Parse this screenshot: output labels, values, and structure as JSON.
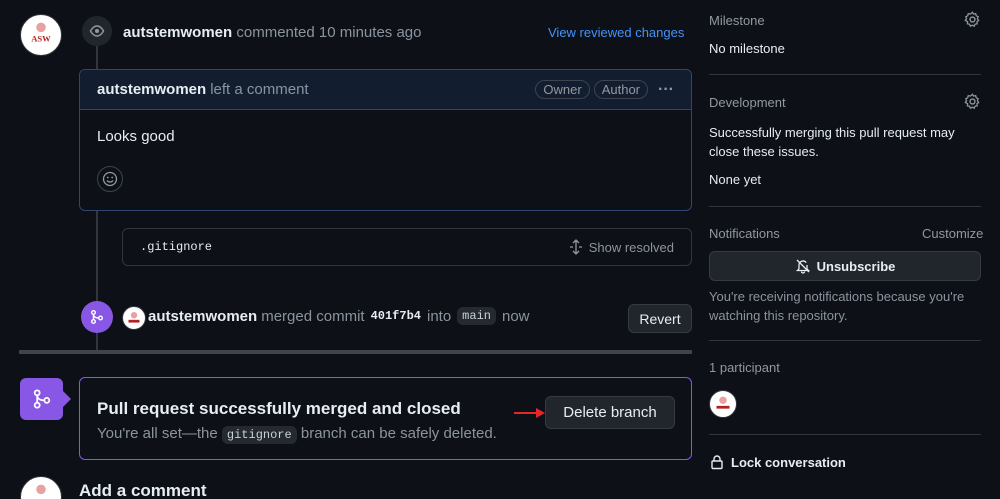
{
  "comment_header": {
    "author": "autstemwomen",
    "action": "commented 10 minutes ago",
    "view_changes": "View reviewed changes"
  },
  "comment": {
    "author": "autstemwomen",
    "action": "left a comment",
    "badge_owner": "Owner",
    "badge_author": "Author",
    "more": "···",
    "body": "Looks good"
  },
  "file_row": {
    "filename": ".gitignore",
    "show_resolved": "Show resolved"
  },
  "merge_event": {
    "author": "autstemwomen",
    "text_merged": "merged commit",
    "commit": "401f7b4",
    "text_into": "into",
    "branch": "main",
    "time": "now",
    "revert": "Revert"
  },
  "merged_box": {
    "title": "Pull request successfully merged and closed",
    "desc_before": "You're all set—the",
    "branch": "gitignore",
    "desc_after": "branch can be safely deleted.",
    "delete_branch": "Delete branch"
  },
  "add_comment": "Add a comment",
  "avatar_text": "ASW",
  "sidebar": {
    "milestone_title": "Milestone",
    "milestone_value": "No milestone",
    "development_title": "Development",
    "development_text": "Successfully merging this pull request may close these issues.",
    "development_value": "None yet",
    "notifications_title": "Notifications",
    "customize": "Customize",
    "unsubscribe": "Unsubscribe",
    "notifications_text": "You're receiving notifications because you're watching this repository.",
    "participants": "1 participant",
    "lock": "Lock conversation"
  },
  "colors": {
    "accent_blue": "#4493f8",
    "merged_purple": "#8957e5",
    "arrow_red": "#e5262a"
  }
}
